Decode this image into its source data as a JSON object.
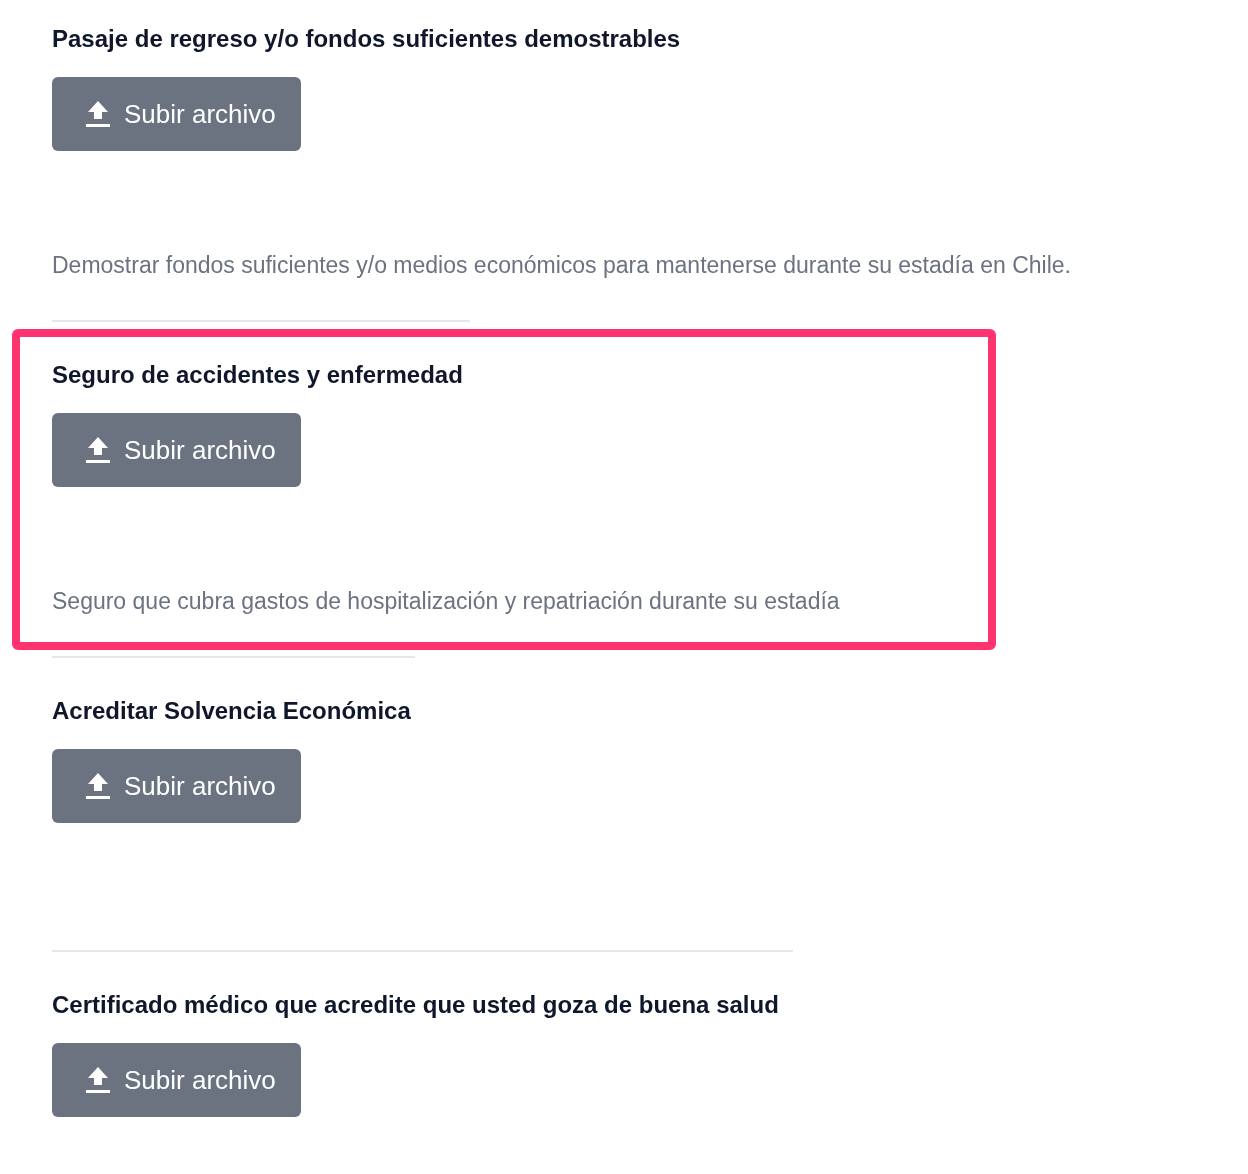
{
  "sections": [
    {
      "title": "Pasaje de regreso y/o fondos suficientes demostrables",
      "button": "Subir archivo",
      "description": "Demostrar fondos suficientes y/o medios económicos para mantenerse durante su estadía en Chile.",
      "highlighted": false
    },
    {
      "title": "Seguro de accidentes y enfermedad",
      "button": "Subir archivo",
      "description": "Seguro que cubra gastos de hospitalización y repatriación durante su estadía",
      "highlighted": true
    },
    {
      "title": "Acreditar Solvencia Económica",
      "button": "Subir archivo",
      "highlighted": false
    },
    {
      "title": "Certificado médico que acredite que usted goza de buena salud",
      "button": "Subir archivo",
      "highlighted": false
    }
  ]
}
